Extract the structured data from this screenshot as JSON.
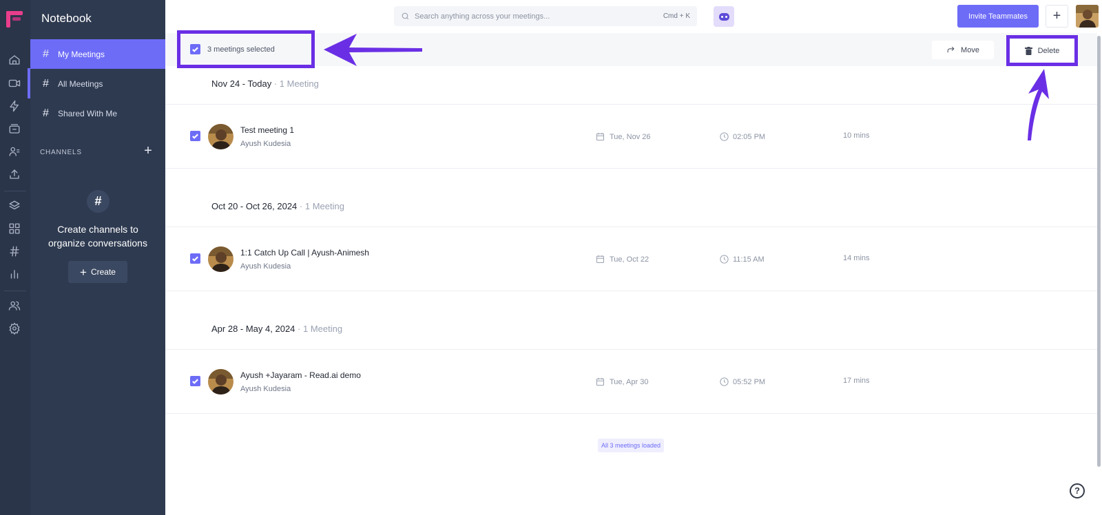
{
  "app": {
    "title": "Notebook",
    "accent": "#6d6cf7",
    "annotation_color": "#6a2fe5"
  },
  "rail": {
    "icons": [
      "logo-icon",
      "home-icon",
      "video-icon",
      "bolt-icon",
      "inbox-icon",
      "contacts-icon",
      "upload-icon",
      "layers-icon",
      "grid-icon",
      "hash-icon",
      "chart-icon",
      "team-icon",
      "settings-icon"
    ]
  },
  "sidebar": {
    "items": [
      {
        "label": "My Meetings",
        "active": true
      },
      {
        "label": "All Meetings",
        "active": false
      },
      {
        "label": "Shared With Me",
        "active": false
      }
    ],
    "channels_label": "CHANNELS",
    "empty_line1": "Create channels to",
    "empty_line2": "organize conversations",
    "create_label": "Create"
  },
  "topbar": {
    "search_placeholder": "Search anything across your meetings...",
    "shortcut": "Cmd + K",
    "invite_label": "Invite Teammates"
  },
  "selection": {
    "label": "3 meetings selected",
    "move_label": "Move",
    "delete_label": "Delete"
  },
  "groups": [
    {
      "range": "Nov 24 - Today",
      "count": "1 Meeting",
      "meeting": {
        "title": "Test meeting 1",
        "owner": "Ayush Kudesia",
        "date": "Tue, Nov 26",
        "time": "02:05 PM",
        "duration": "10 mins",
        "selected": true
      }
    },
    {
      "range": "Oct 20 - Oct 26, 2024",
      "count": "1 Meeting",
      "meeting": {
        "title": "1:1 Catch Up Call | Ayush-Animesh",
        "owner": "Ayush Kudesia",
        "date": "Tue, Oct 22",
        "time": "11:15 AM",
        "duration": "14 mins",
        "selected": true
      }
    },
    {
      "range": "Apr 28 - May 4, 2024",
      "count": "1 Meeting",
      "meeting": {
        "title": "Ayush +Jayaram - Read.ai demo",
        "owner": "Ayush Kudesia",
        "date": "Tue, Apr 30",
        "time": "05:52 PM",
        "duration": "17 mins",
        "selected": true
      }
    }
  ],
  "footer": {
    "loaded_label": "All 3 meetings loaded",
    "help": "?"
  }
}
